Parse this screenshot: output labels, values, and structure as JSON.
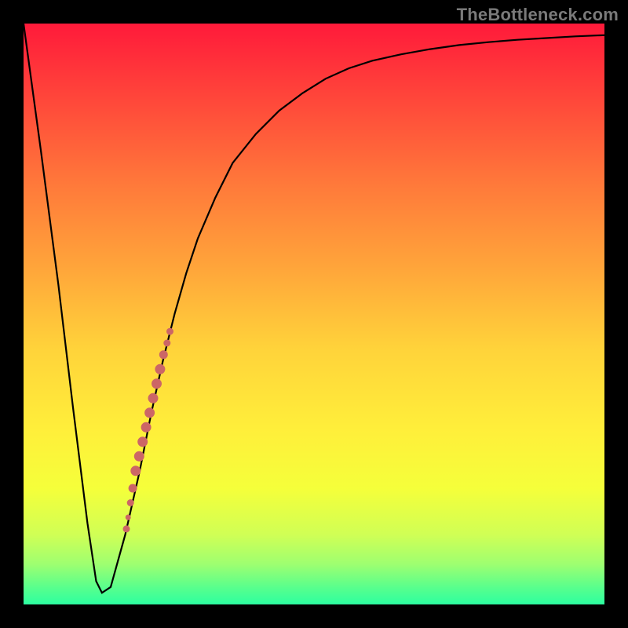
{
  "watermark": "TheBottleneck.com",
  "chart_data": {
    "type": "line",
    "title": "",
    "xlabel": "",
    "ylabel": "",
    "xlim": [
      0,
      100
    ],
    "ylim": [
      0,
      100
    ],
    "series": [
      {
        "name": "bottleneck-curve",
        "x": [
          0,
          3,
          6,
          8.5,
          11,
          12.5,
          13.5,
          15,
          17.5,
          20,
          22,
          24,
          26,
          28,
          30,
          33,
          36,
          40,
          44,
          48,
          52,
          56,
          60,
          65,
          70,
          75,
          80,
          85,
          90,
          95,
          100
        ],
        "values": [
          100,
          78,
          55,
          34,
          14,
          4,
          2,
          3,
          12,
          23,
          33,
          42,
          50,
          57,
          63,
          70,
          76,
          81,
          85,
          88,
          90.5,
          92.3,
          93.6,
          94.7,
          95.6,
          96.3,
          96.8,
          97.2,
          97.5,
          97.8,
          98
        ]
      }
    ],
    "highlight_points": [
      {
        "x": 17.7,
        "value": 13,
        "r": 4
      },
      {
        "x": 18.0,
        "value": 15,
        "r": 3
      },
      {
        "x": 18.4,
        "value": 17.5,
        "r": 4
      },
      {
        "x": 18.8,
        "value": 20,
        "r": 5
      },
      {
        "x": 19.3,
        "value": 23,
        "r": 6
      },
      {
        "x": 19.9,
        "value": 25.5,
        "r": 6
      },
      {
        "x": 20.5,
        "value": 28,
        "r": 6
      },
      {
        "x": 21.1,
        "value": 30.5,
        "r": 6
      },
      {
        "x": 21.7,
        "value": 33,
        "r": 6
      },
      {
        "x": 22.3,
        "value": 35.5,
        "r": 6
      },
      {
        "x": 22.9,
        "value": 38,
        "r": 6
      },
      {
        "x": 23.5,
        "value": 40.5,
        "r": 6
      },
      {
        "x": 24.1,
        "value": 43,
        "r": 5
      },
      {
        "x": 24.7,
        "value": 45,
        "r": 4
      },
      {
        "x": 25.2,
        "value": 47,
        "r": 4
      }
    ],
    "colors": {
      "curve": "#000000",
      "point_fill": "#cc6666",
      "point_stroke": "#cc6666"
    }
  }
}
